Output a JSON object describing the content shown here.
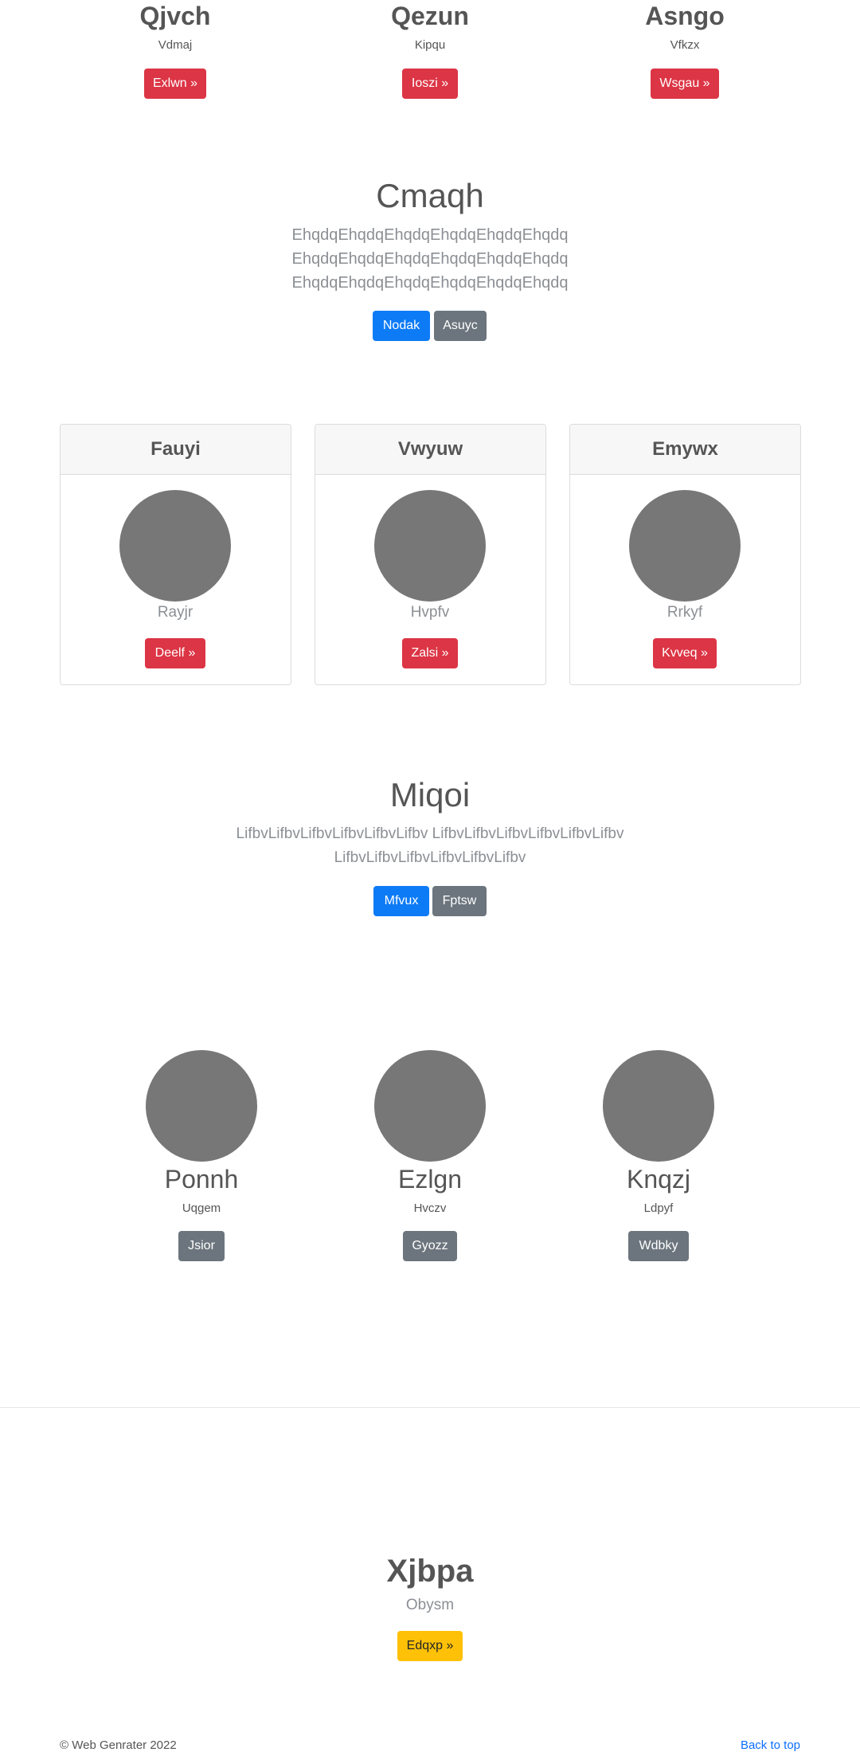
{
  "top_features": [
    {
      "title": "Qjvch",
      "subtitle": "Vdmaj",
      "button": "Exlwn »"
    },
    {
      "title": "Qezun",
      "subtitle": "Kipqu",
      "button": "Ioszi »"
    },
    {
      "title": "Asngo",
      "subtitle": "Vfkzx",
      "button": "Wsgau »"
    }
  ],
  "hero1": {
    "title": "Cmaqh",
    "lines": [
      "EhqdqEhqdqEhqdqEhqdqEhqdqEhqdq",
      "EhqdqEhqdqEhqdqEhqdqEhqdqEhqdq",
      "EhqdqEhqdqEhqdqEhqdqEhqdqEhqdq"
    ],
    "primary": "Nodak",
    "secondary": "Asuyc"
  },
  "cards": [
    {
      "header": "Fauyi",
      "name": "Rayjr",
      "button": "Deelf »"
    },
    {
      "header": "Vwyuw",
      "name": "Hvpfv",
      "button": "Zalsi »"
    },
    {
      "header": "Emywx",
      "name": "Rrkyf",
      "button": "Kvveq »"
    }
  ],
  "hero2": {
    "title": "Miqoi",
    "lines": [
      "LifbvLifbvLifbvLifbvLifbvLifbv LifbvLifbvLifbvLifbvLifbvLifbv",
      "LifbvLifbvLifbvLifbvLifbvLifbv"
    ],
    "primary": "Mfvux",
    "secondary": "Fptsw"
  },
  "team": [
    {
      "name": "Ponnh",
      "role": "Uqgem",
      "button": "Jsior"
    },
    {
      "name": "Ezlgn",
      "role": "Hvczv",
      "button": "Gyozz"
    },
    {
      "name": "Knqzj",
      "role": "Ldpyf",
      "button": "Wdbky"
    }
  ],
  "cta": {
    "title": "Xjbpa",
    "subtitle": "Obysm",
    "button": "Edqxp »"
  },
  "footer": {
    "copyright": "© Web Genrater 2022",
    "back_to_top": "Back to top"
  },
  "colors": {
    "danger": "#dc3545",
    "primary": "#0d7bf6",
    "secondary": "#6c757d",
    "warning": "#ffc107",
    "link": "#0d6efd"
  }
}
